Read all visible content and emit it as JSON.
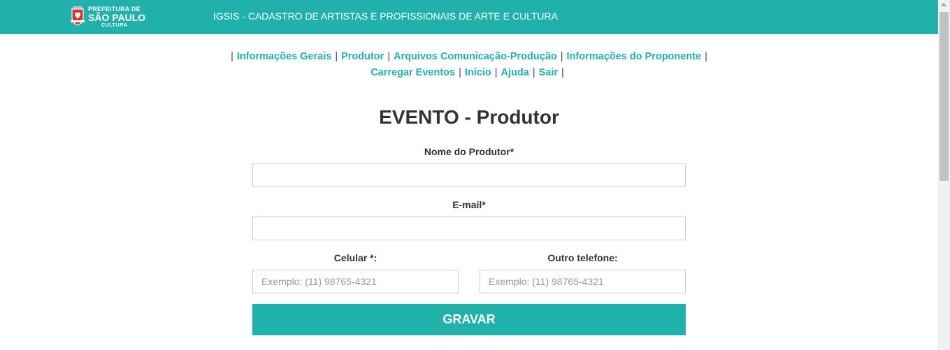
{
  "header": {
    "logo": {
      "line1": "PREFEITURA DE",
      "line2": "SÃO PAULO",
      "line3": "CULTURA"
    },
    "app_title": "IGSIS - CADASTRO DE ARTISTAS E PROFISSIONAIS DE ARTE E CULTURA",
    "background_color": "#20b2aa"
  },
  "nav": {
    "separator": "|",
    "items": [
      {
        "label": "Informações Gerais"
      },
      {
        "label": "Produtor"
      },
      {
        "label": "Arquivos Comunicação-Produção"
      },
      {
        "label": "Informações do Proponente"
      },
      {
        "label": "Carregar Eventos"
      },
      {
        "label": "Início"
      },
      {
        "label": "Ajuda"
      },
      {
        "label": "Sair"
      }
    ],
    "link_color": "#20b2aa"
  },
  "form": {
    "title": "EVENTO - Produtor",
    "fields": {
      "nome": {
        "label": "Nome do Produtor*",
        "value": "",
        "placeholder": ""
      },
      "email": {
        "label": "E-mail*",
        "value": "",
        "placeholder": ""
      },
      "celular": {
        "label": "Celular *:",
        "value": "",
        "placeholder": "Exemplo: (11) 98765-4321"
      },
      "outro_telefone": {
        "label": "Outro telefone:",
        "value": "",
        "placeholder": "Exemplo: (11) 98765-4321"
      }
    },
    "submit_label": "GRAVAR",
    "accent_color": "#20b2aa"
  }
}
